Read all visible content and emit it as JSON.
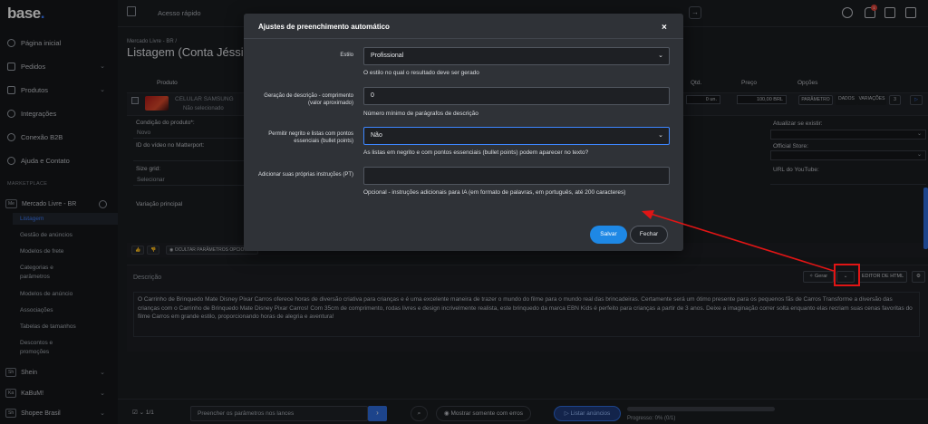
{
  "brand": {
    "logo": "base",
    "logo_dot": "."
  },
  "topbar": {
    "quick_access": "Acesso rápido",
    "notif_count": "1"
  },
  "sidebar": {
    "items": [
      {
        "label": "Página inicial"
      },
      {
        "label": "Pedidos"
      },
      {
        "label": "Produtos"
      },
      {
        "label": "Integrações"
      },
      {
        "label": "Conexão B2B"
      },
      {
        "label": "Ajuda e Contato"
      }
    ],
    "section_title": "MARKETPLACE",
    "markets": [
      {
        "tag": "Me",
        "label": "Mercado Livre - BR"
      },
      {
        "tag": "Sh",
        "label": "Shein"
      },
      {
        "tag": "Ka",
        "label": "KaBuM!"
      },
      {
        "tag": "Sh",
        "label": "Shopee Brasil"
      }
    ],
    "submenu": [
      "Listagem",
      "Gestão de anúncios",
      "Modelos de frete",
      "Categorias e parâmetros",
      "Modelos de anúncio",
      "Associações",
      "Tabelas de tamanhos",
      "Descontos e promoções"
    ]
  },
  "page": {
    "breadcrumb": "Mercado Livre - BR /",
    "title": "Listagem (Conta Jéssica Ri",
    "columns": {
      "product": "Produto",
      "qty": "Qtd.",
      "price": "Preço",
      "options": "Opções"
    },
    "product": {
      "name": "CELULAR SAMSUNG",
      "selected": "Não selecionado",
      "qty": "0",
      "qty_unit": "un.",
      "price": "100,00",
      "currency": "BRL"
    },
    "row_buttons": [
      "PARÂMETRO",
      "DADOS",
      "VARIAÇÕES",
      "3"
    ],
    "fields": {
      "condition_label": "Condição do produto*:",
      "condition_value": "Novo",
      "matterport_label": "ID do vídeo no Matterport:",
      "size_grid_label": "Size grid:",
      "size_grid_value": "Selecionar",
      "variation_label": "Variação principal",
      "update_label": "Atualizar se existir:",
      "store_label": "Official Store:",
      "youtube_label": "URL do YouTube:"
    },
    "action_bar": {
      "hide_params": "OCULTAR PARÂMETROS OPCIONAIS"
    },
    "description": {
      "label": "Descrição",
      "generate": "Gerar",
      "html_editor": "EDITOR DE HTML",
      "text": "O Carrinho de Brinquedo Mate Disney Pixar Carros oferece horas de diversão criativa para crianças e é uma excelente maneira de trazer o mundo do filme para o mundo real das brincadeiras. Certamente será um ótimo presente para os pequenos fãs de Carros Transforme a diversão das crianças com o Carrinho de Brinquedo Mate Disney Pixar Carros! Com 35cm de comprimento, rodas livres e design incrivelmente realista, este brinquedo da marca EBN Kids é perfeito para crianças a partir de 3 anos. Deixe a imaginação correr solta enquanto elas recriam suas cenas favoritas do filme Carros em grande estilo, proporcionando horas de alegria e aventura!"
    }
  },
  "footer": {
    "pagination": "1/1",
    "fill_params": "Preencher os parâmetros nos lances",
    "show_errors": "Mostrar somente com erros",
    "list_button": "Listar anúncios",
    "progress_text": "Progresso: 0% (0/1)",
    "progress_value": 0
  },
  "modal": {
    "title": "Ajustes de preenchimento automático",
    "close": "×",
    "style_label": "Estilo",
    "style_value": "Profissional",
    "style_help": "O estilo no qual o resultado deve ser gerado",
    "length_label": "Geração de descrição - comprimento (valor aproximado)",
    "length_value": "0",
    "length_help": "Número mínimo de parágrafos de descrição",
    "bold_label": "Permitir negrito e listas com pontos essenciais (bullet points)",
    "bold_value": "Não",
    "bold_help": "As listas em negrito e com pontos essenciais (bullet points) podem aparecer no texto?",
    "instr_label": "Adicionar suas próprias instruções (PT)",
    "instr_value": "",
    "instr_help": "Opcional - instruções adicionais para IA (em formato de palavras, em português, até 200 caracteres)",
    "save": "Salvar",
    "cancel": "Fechar"
  },
  "colors": {
    "accent": "#1e88e5",
    "annotation": "#e01515"
  }
}
